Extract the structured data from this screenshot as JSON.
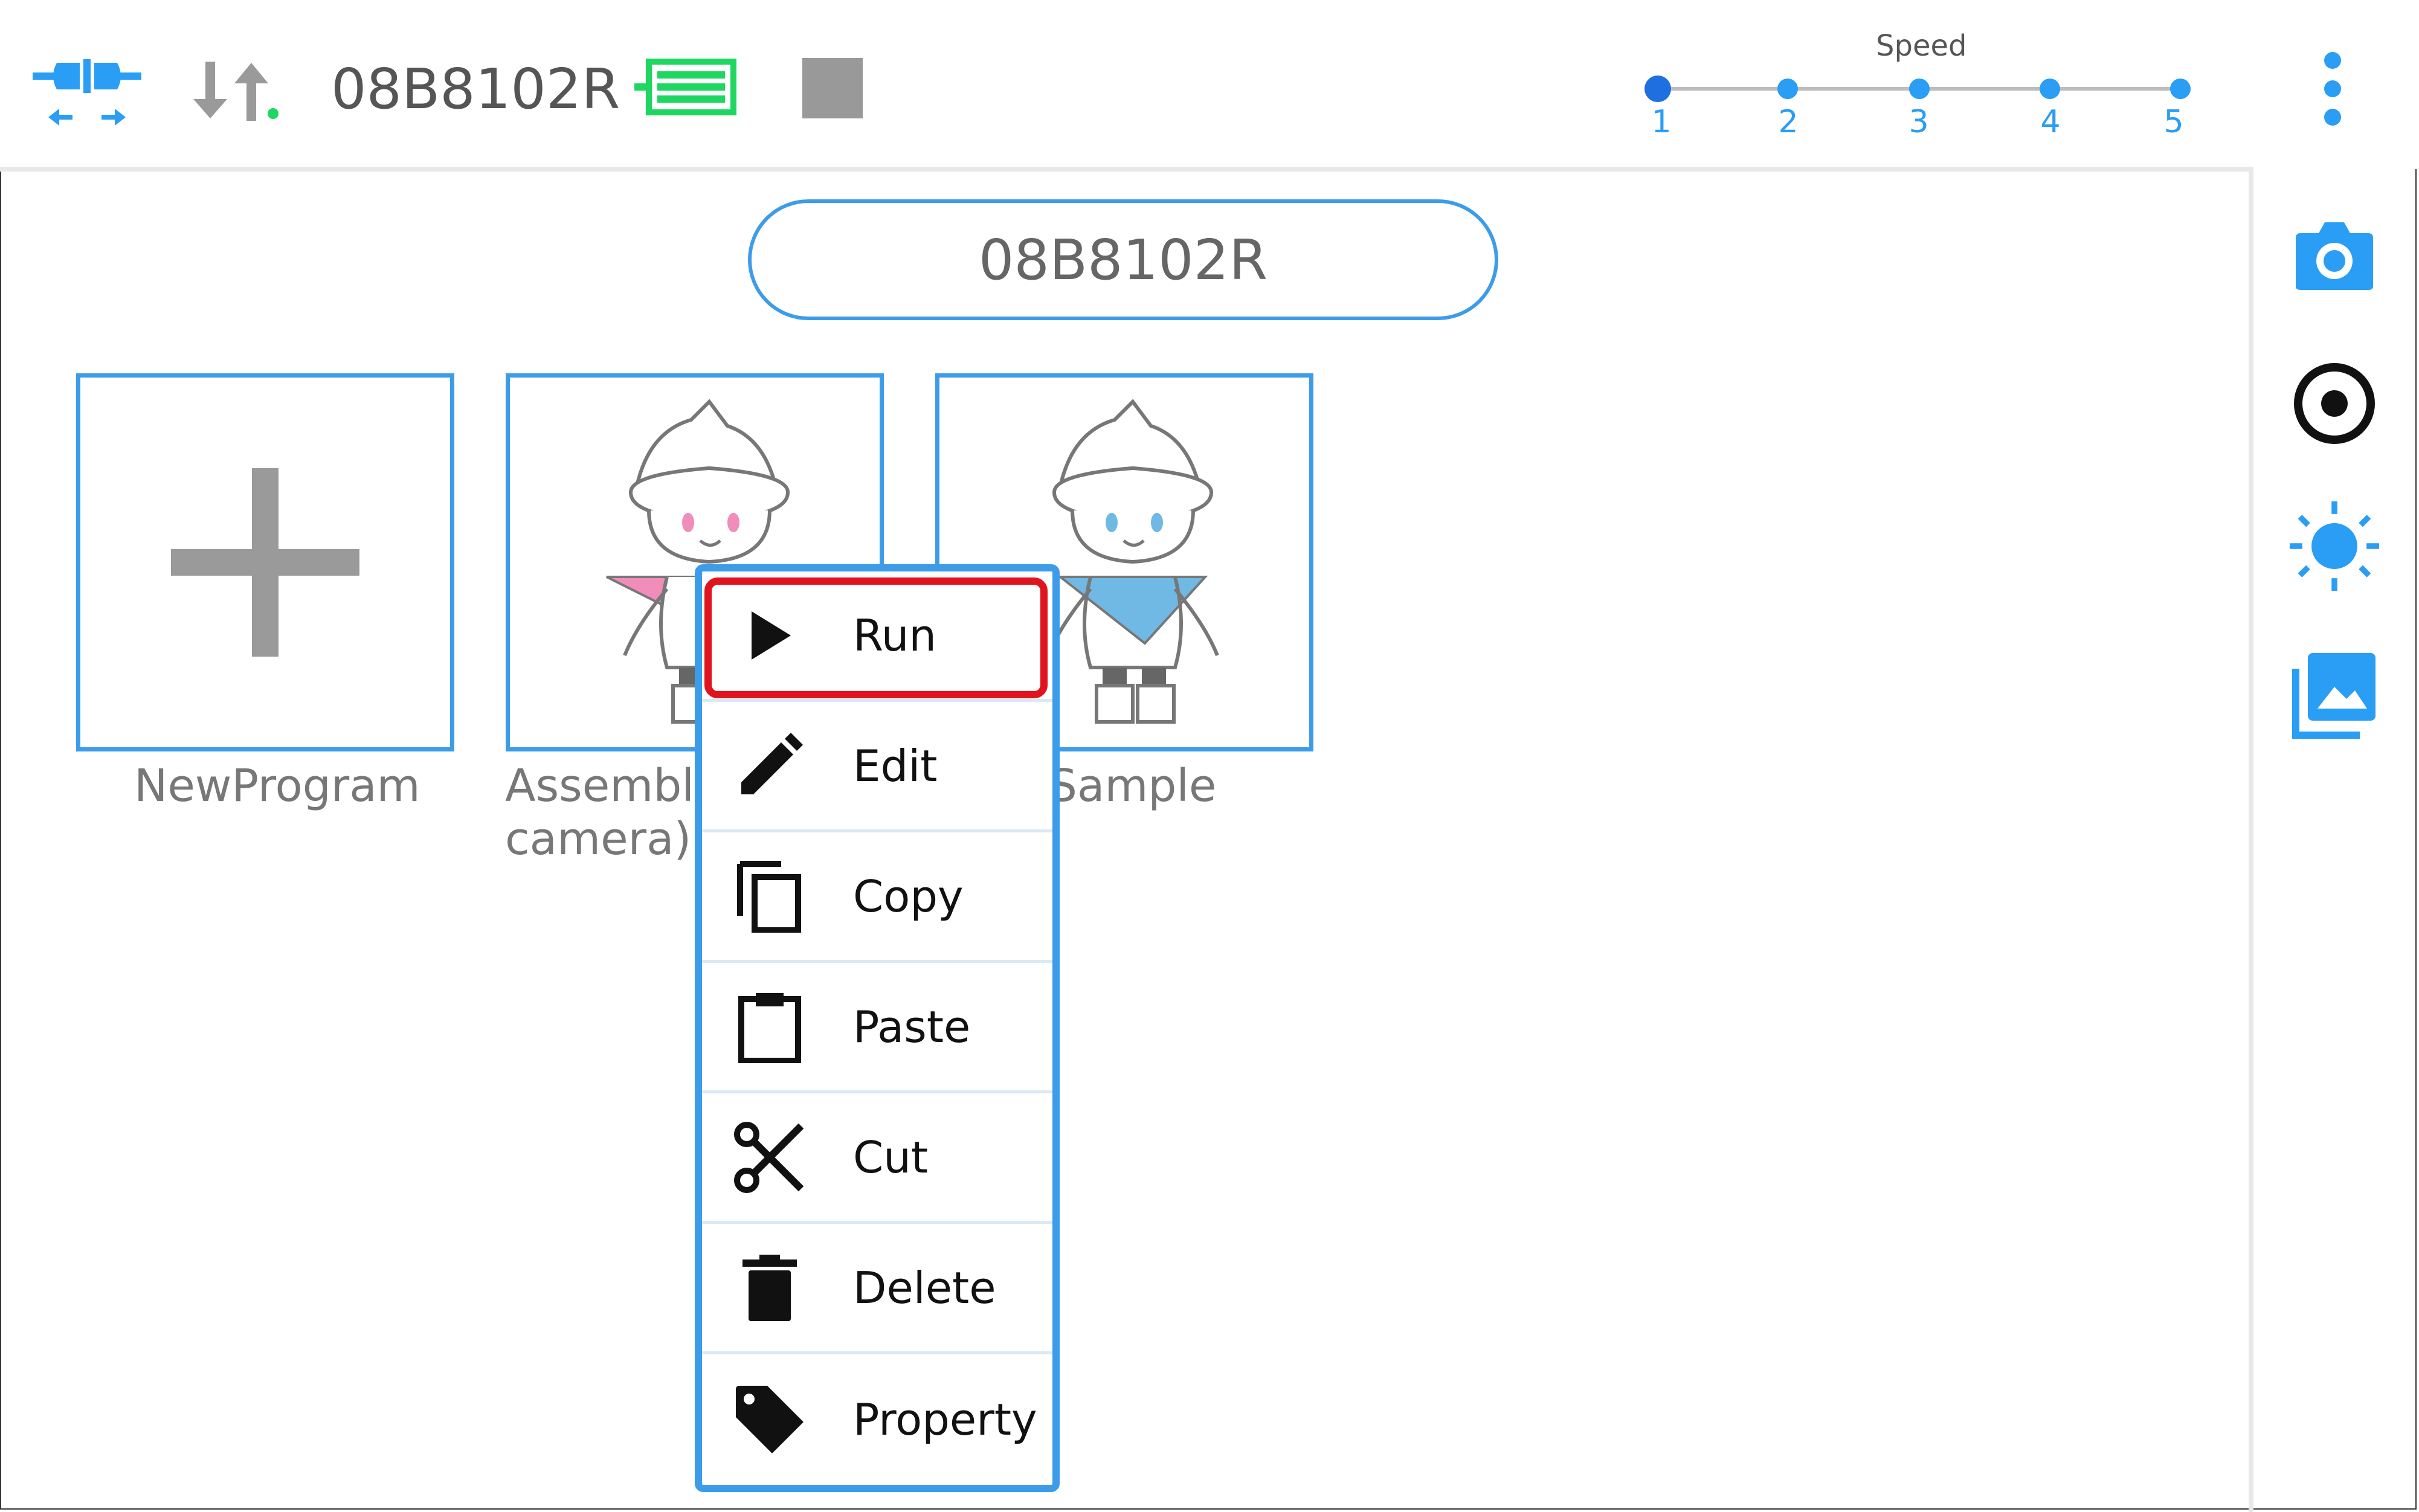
{
  "toolbar": {
    "device_id": "08B8102R",
    "icons": {
      "connect": "plug-connect-icon",
      "transfer": "transfer-arrows-icon",
      "battery": "battery-icon",
      "stop": "stop-square-icon",
      "menu": "more-vert-icon"
    },
    "speed": {
      "title": "Speed",
      "levels": [
        "1",
        "2",
        "3",
        "4",
        "5"
      ],
      "selected": 1
    }
  },
  "main": {
    "title": "08B8102R",
    "programs": [
      {
        "label": "NewProgram",
        "icon": "plus-icon"
      },
      {
        "label_line1": "Assembly",
        "label_line2": "camera)",
        "icon": "robot-character-pink"
      },
      {
        "label": "Sample",
        "icon": "robot-character-blue"
      }
    ]
  },
  "context_menu": {
    "items": [
      {
        "label": "Run",
        "icon": "play-icon",
        "selected": true
      },
      {
        "label": "Edit",
        "icon": "pencil-icon"
      },
      {
        "label": "Copy",
        "icon": "copy-icon"
      },
      {
        "label": "Paste",
        "icon": "clipboard-icon"
      },
      {
        "label": "Cut",
        "icon": "scissors-icon"
      },
      {
        "label": "Delete",
        "icon": "trash-icon"
      },
      {
        "label": "Property",
        "icon": "tag-icon"
      }
    ]
  },
  "right_rail": {
    "icons": [
      "camera-icon",
      "record-icon",
      "brightness-icon",
      "gallery-icon"
    ]
  },
  "colors": {
    "accent": "#3d9cea",
    "speed": "#2a9df4",
    "battery": "#1ed760",
    "selection": "#e0141e",
    "gray_icon": "#9a9a9a"
  }
}
